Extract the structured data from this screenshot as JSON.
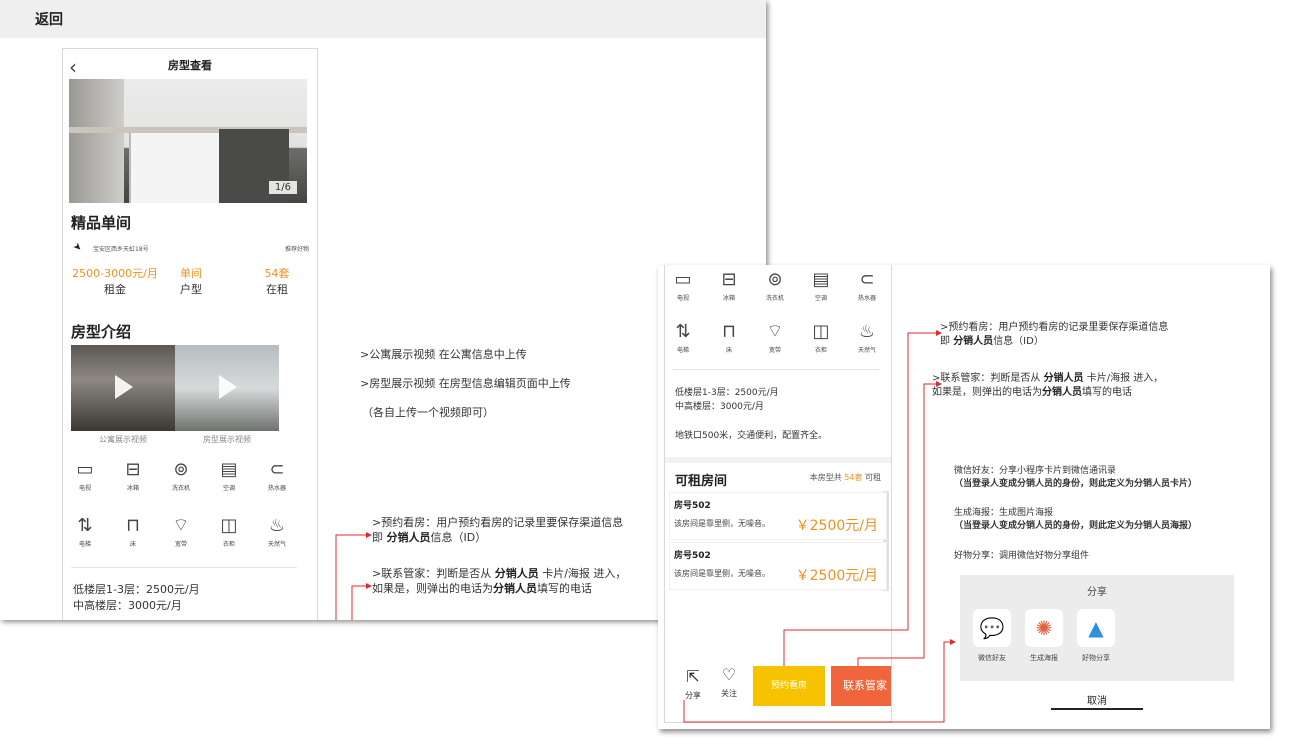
{
  "colors": {
    "accent": "#f29020",
    "arrow": "#e8262d",
    "yellow_button": "#f7c300",
    "red_button": "#f0653c"
  },
  "panel1": {
    "back": "返回",
    "phone": {
      "title": "房型查看",
      "image_counter": "1/6",
      "room_name": "精品单间",
      "address": "宝安区西乡天虹18号",
      "recommend": "推荐好物",
      "stats": [
        {
          "value": "2500-3000元/月",
          "label": "租金"
        },
        {
          "value": "单间",
          "label": "户型"
        },
        {
          "value": "54套",
          "label": "在租"
        }
      ],
      "intro_title": "房型介绍",
      "video_captions": [
        "公寓展示视频",
        "房型展示视频"
      ],
      "facilities_row1": [
        {
          "icon": "tv-icon",
          "glyph": "▭",
          "label": "电视"
        },
        {
          "icon": "fridge-icon",
          "glyph": "⊟",
          "label": "冰箱"
        },
        {
          "icon": "washer-icon",
          "glyph": "⊚",
          "label": "洗衣机"
        },
        {
          "icon": "aircon-icon",
          "glyph": "▤",
          "label": "空调"
        },
        {
          "icon": "water-heater-icon",
          "glyph": "⊂",
          "label": "热水器"
        }
      ],
      "facilities_row2": [
        {
          "icon": "elevator-icon",
          "glyph": "⇅",
          "label": "电梯"
        },
        {
          "icon": "bed-icon",
          "glyph": "⊓",
          "label": "床"
        },
        {
          "icon": "wifi-icon",
          "glyph": "⌔",
          "label": "宽带"
        },
        {
          "icon": "wardrobe-icon",
          "glyph": "◫",
          "label": "衣柜"
        },
        {
          "icon": "gas-icon",
          "glyph": "♨",
          "label": "天然气"
        }
      ],
      "floor_low": "低楼层1-3层：2500元/月",
      "floor_mid": "中高楼层：3000元/月"
    },
    "notes": {
      "video1": ">公寓展示视频  在公寓信息中上传",
      "video2": ">房型展示视频  在房型信息编辑页面中上传",
      "video3": "（各自上传一个视频即可）",
      "book_a": ">预约看房：用户预约看房的记录里要保存渠道信息",
      "book_b_pre": "即 ",
      "book_b_bold": "分销人员",
      "book_b_post": "信息（ID）",
      "contact_a_pre": ">联系管家：判断是否从 ",
      "contact_a_bold": "分销人员",
      "contact_a_post": " 卡片/海报 进入，",
      "contact_b_pre": "如果是，则弹出的电话为",
      "contact_b_bold": "分销人员",
      "contact_b_post": "填写的电话"
    }
  },
  "panel2": {
    "phone": {
      "facilities_row1": [
        {
          "icon": "tv-icon",
          "glyph": "▭",
          "label": "电视"
        },
        {
          "icon": "fridge-icon",
          "glyph": "⊟",
          "label": "冰箱"
        },
        {
          "icon": "washer-icon",
          "glyph": "⊚",
          "label": "洗衣机"
        },
        {
          "icon": "aircon-icon",
          "glyph": "▤",
          "label": "空调"
        },
        {
          "icon": "water-heater-icon",
          "glyph": "⊂",
          "label": "热水器"
        }
      ],
      "facilities_row2": [
        {
          "icon": "elevator-icon",
          "glyph": "⇅",
          "label": "电梯"
        },
        {
          "icon": "bed-icon",
          "glyph": "⊓",
          "label": "床"
        },
        {
          "icon": "wifi-icon",
          "glyph": "⌔",
          "label": "宽带"
        },
        {
          "icon": "wardrobe-icon",
          "glyph": "◫",
          "label": "衣柜"
        },
        {
          "icon": "gas-icon",
          "glyph": "♨",
          "label": "天然气"
        }
      ],
      "floor_low": "低楼层1-3层：2500元/月",
      "floor_mid": "中高楼层：3000元/月",
      "traffic": "地铁口500米，交通便利，配置齐全。",
      "rentable_title": "可租房间",
      "rentable_pre": "本房型共",
      "rentable_count": "54套",
      "rentable_post": "可租",
      "rooms": [
        {
          "no": "房号502",
          "desc": "该房间是靠里侧，无噪音。",
          "price": "￥2500元/月"
        },
        {
          "no": "房号502",
          "desc": "该房间是靠里侧，无噪音。",
          "price": "￥2500元/月"
        }
      ],
      "share": "分享",
      "follow": "关注",
      "book": "预约看房",
      "contact": "联系管家"
    },
    "notes": {
      "book_a": ">预约看房：用户预约看房的记录里要保存渠道信息",
      "book_b_pre": "即 ",
      "book_b_bold": "分销人员",
      "book_b_post": "信息（ID）",
      "contact_a_pre": ">联系管家：判断是否从 ",
      "contact_a_bold": "分销人员",
      "contact_a_post": " 卡片/海报 进入，",
      "contact_b_pre": "如果是，则弹出的电话为",
      "contact_b_bold": "分销人员",
      "contact_b_post": "填写的电话",
      "friend": "微信好友：分享小程序卡片到微信通讯录",
      "friend_bold": "（当登录人变成分销人员的身份，则此定义为分销人员卡片）",
      "poster": "生成海报：生成图片海报",
      "poster_bold": "（当登录人变成分销人员的身份，则此定义为分销人员海报）",
      "goods": "好物分享：调用微信好物分享组件"
    },
    "share_sheet": {
      "title": "分享",
      "items": [
        {
          "icon": "wechat-icon",
          "glyph": "💬",
          "label": "微信好友",
          "color": "#3fbf3f"
        },
        {
          "icon": "poster-icon",
          "glyph": "✺",
          "label": "生成海报",
          "color": "#e0613f"
        },
        {
          "icon": "goods-share-icon",
          "glyph": "▲",
          "label": "好物分享",
          "color": "#2f8fe0"
        }
      ],
      "cancel": "取消"
    }
  }
}
